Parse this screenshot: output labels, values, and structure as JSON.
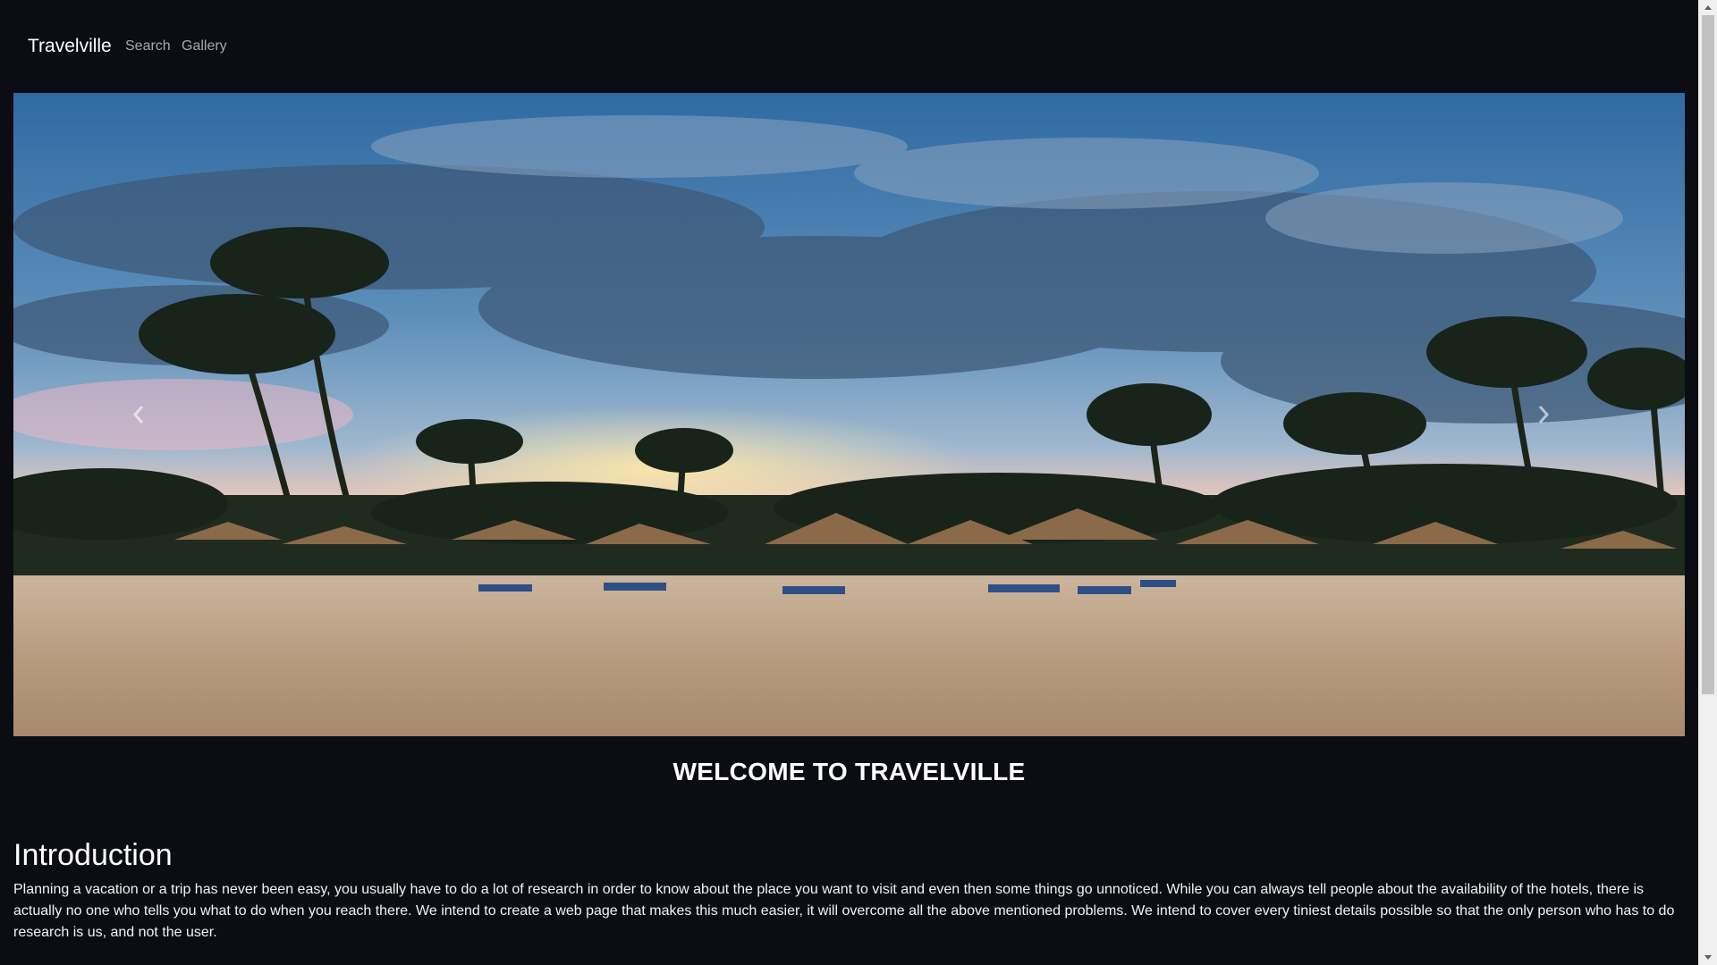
{
  "navbar": {
    "brand": "Travelville",
    "links": [
      {
        "label": "Search"
      },
      {
        "label": "Gallery"
      }
    ]
  },
  "carousel": {
    "image_description_icon": "beach-palm-sunset-image",
    "prev_icon": "chevron-left-icon",
    "next_icon": "chevron-right-icon"
  },
  "main": {
    "welcome": "WELCOME TO TRAVELVILLE",
    "intro_title": "Introduction",
    "intro_text": "Planning a vacation or a trip has never been easy, you usually have to do a lot of research in order to know about the place you want to visit and even then some things go unnoticed. While you can always tell people about the availability of the hotels, there is actually no one who tells you what to do when you reach there. We intend to create a web page that makes this much easier, it will overcome all the above mentioned problems. We intend to cover every tiniest details possible so that the only person who has to do research is us, and not the user."
  },
  "colors": {
    "background": "#0b0d12",
    "nav_link": "#a6a9ae",
    "text": "#ffffff"
  }
}
